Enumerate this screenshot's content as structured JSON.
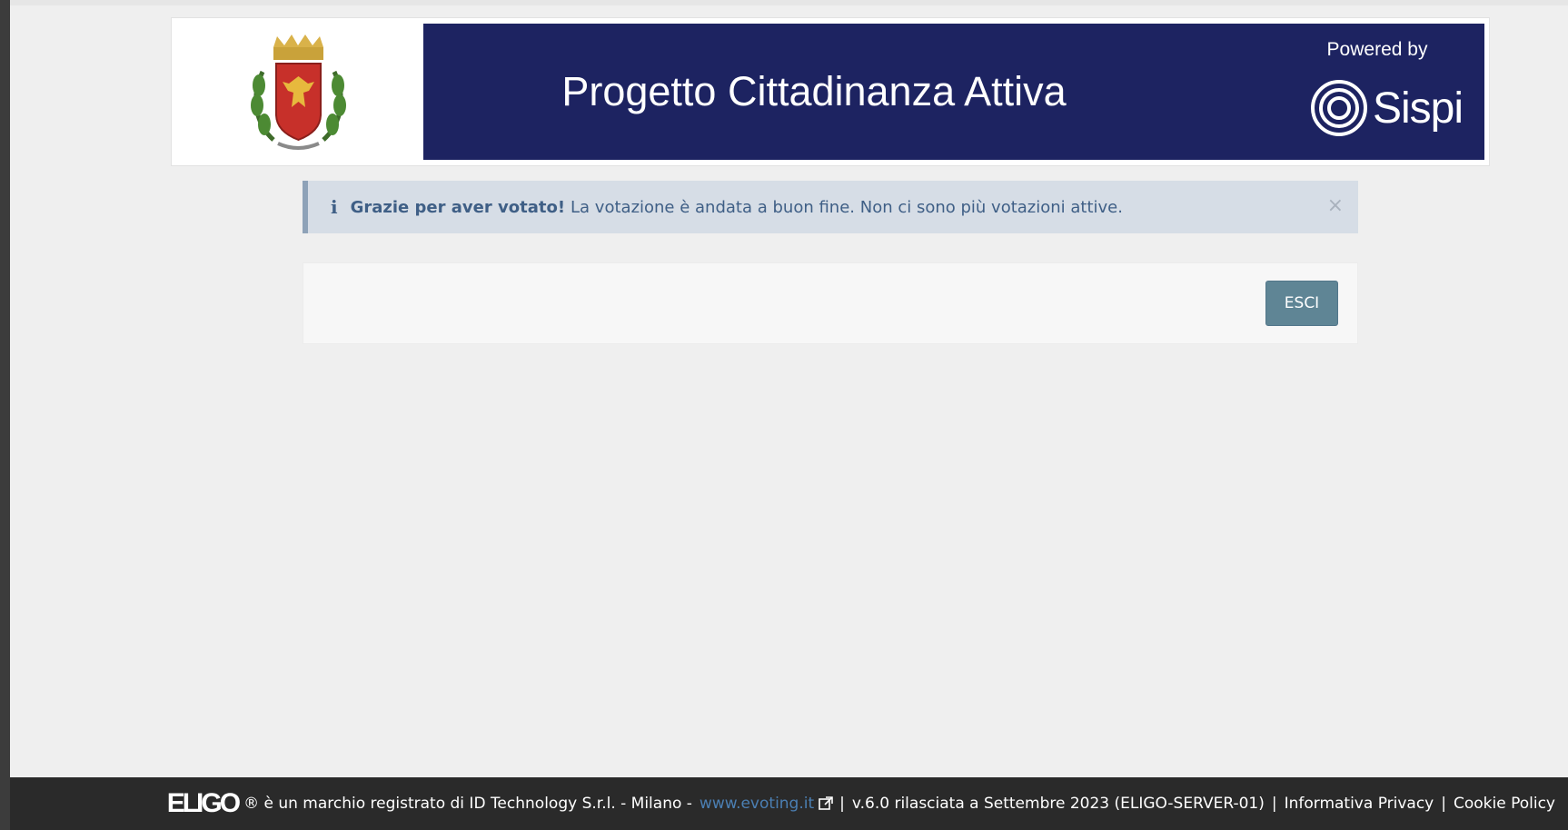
{
  "header": {
    "title": "Progetto Cittadinanza Attiva",
    "powered_by": "Powered by",
    "sponsor_name": "Sispi",
    "colors": {
      "banner_background": "#1d2361",
      "text": "#ffffff"
    }
  },
  "alert": {
    "icon": "info-icon",
    "strong_text": "Grazie per aver votato!",
    "message": "La votazione è andata a buon fine. Non ci sono più votazioni attive.",
    "close_label": "×",
    "colors": {
      "background": "#d6dde6",
      "text": "#3f5f86"
    }
  },
  "panel": {
    "exit_label": "ESCI",
    "colors": {
      "button": "#5f8595"
    }
  },
  "footer": {
    "brand": "ELIGO",
    "registered_text": "® è un marchio registrato di ID Technology S.r.l. - Milano -",
    "link_text": "www.evoting.it",
    "version_text": "v.6.0 rilasciata a Settembre 2023 (ELIGO-SERVER-01)",
    "separator": "|",
    "privacy_link": "Informativa Privacy",
    "cookie_link": "Cookie Policy",
    "colors": {
      "background": "#2a2a2a",
      "link": "#4b7fb3"
    }
  }
}
